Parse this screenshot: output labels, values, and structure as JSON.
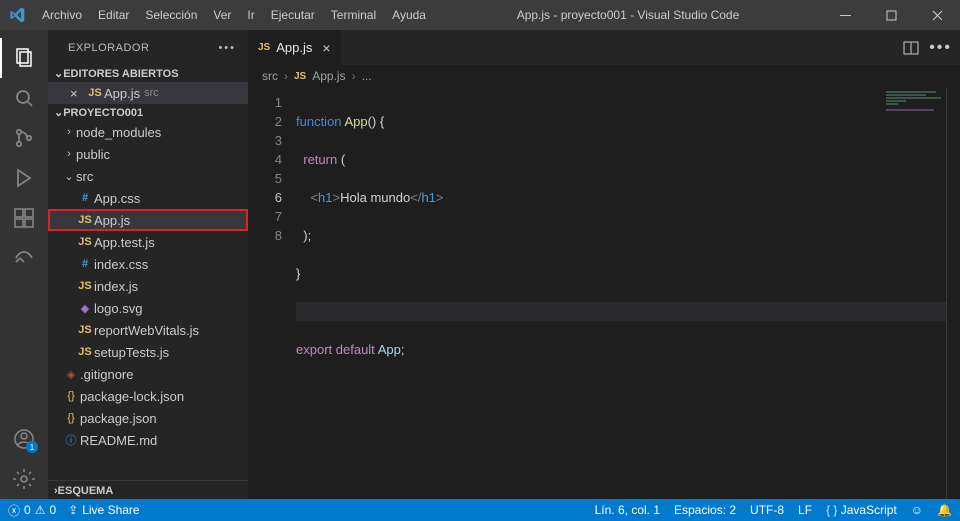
{
  "titlebar": {
    "menus": [
      "Archivo",
      "Editar",
      "Selección",
      "Ver",
      "Ir",
      "Ejecutar",
      "Terminal",
      "Ayuda"
    ],
    "title": "App.js - proyecto001 - Visual Studio Code"
  },
  "activity": {
    "badge": "1"
  },
  "explorer": {
    "title": "EXPLORADOR",
    "open_editors_hd": "EDITORES ABIERTOS",
    "open_editors": [
      {
        "name": "App.js",
        "dir": "src"
      }
    ],
    "project_hd": "PROYECTO001",
    "tree": {
      "node_modules": "node_modules",
      "public": "public",
      "src": "src",
      "src_children": {
        "app_css": "App.css",
        "app_js": "App.js",
        "app_test": "App.test.js",
        "index_css": "index.css",
        "index_js": "index.js",
        "logo_svg": "logo.svg",
        "rwv": "reportWebVitals.js",
        "setup": "setupTests.js"
      },
      "gitignore": ".gitignore",
      "pkg_lock": "package-lock.json",
      "pkg": "package.json",
      "readme": "README.md"
    },
    "outline_hd": "ESQUEMA"
  },
  "tab": {
    "label": "App.js"
  },
  "breadcrumbs": {
    "p0": "src",
    "p1": "App.js",
    "p2": "..."
  },
  "code": {
    "ln": [
      "1",
      "2",
      "3",
      "4",
      "5",
      "6",
      "7",
      "8"
    ],
    "l1_a": "function",
    "l1_b": "App",
    "l1_c": "() {",
    "l2_a": "return",
    "l2_b": "(",
    "l3_a": "<",
    "l3_b": "h1",
    "l3_c": ">",
    "l3_d": "Hola mundo",
    "l3_e": "</",
    "l3_f": "h1",
    "l3_g": ">",
    "l4": ");",
    "l5": "}",
    "l7_a": "export",
    "l7_b": "default",
    "l7_c": "App",
    "l7_d": ";"
  },
  "status": {
    "errors": "0",
    "warnings": "0",
    "live": "Live Share",
    "pos": "Lín. 6, col. 1",
    "spaces": "Espacios: 2",
    "enc": "UTF-8",
    "eol": "LF",
    "lang": "JavaScript"
  }
}
